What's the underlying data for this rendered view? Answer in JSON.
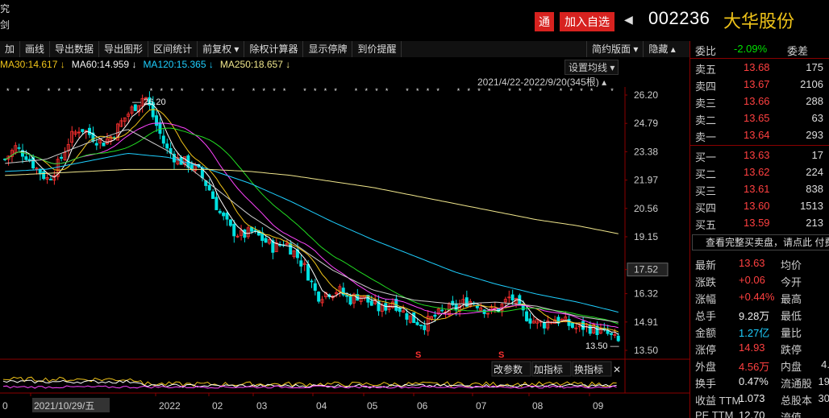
{
  "header": {
    "left_fragment_1": "究",
    "left_fragment_2": "剑",
    "tong_label": "通",
    "add_fav_label": "加入自选",
    "back_arrow": "◀",
    "code": "002236",
    "name": "大华股份"
  },
  "toolbar": {
    "items": [
      "加",
      "画线",
      "导出数据",
      "导出图形",
      "区间统计",
      "前复权 ▾",
      "除权计算器",
      "显示停牌",
      "到价提醒"
    ],
    "right": [
      "简约版面 ▾",
      "隐藏 ▴"
    ]
  },
  "ma_legend": [
    {
      "label": "MA30:14.617 ↓",
      "color": "#f0c419"
    },
    {
      "label": "MA60:14.959 ↓",
      "color": "#eeeeee"
    },
    {
      "label": "MA120:15.365 ↓",
      "color": "#1ecfff"
    },
    {
      "label": "MA250:18.657 ↓",
      "color": "#f0e68c"
    }
  ],
  "set_ma_label": "设置均线 ▾",
  "date_range_label": "2021/4/22-2022/9/20(345根) ▴",
  "colors": {
    "up": "#ff3030",
    "down": "#00e0e0",
    "ma5": "#ffffff",
    "ma10": "#f0c419",
    "ma20": "#ff44ff",
    "ma30": "#22dd22",
    "ma60": "#cccccc",
    "ma120": "#1ecfff",
    "ma250": "#f0e68c"
  },
  "chart_data": {
    "type": "candlestick",
    "y_ticks": [
      "26.20",
      "24.79",
      "23.38",
      "21.97",
      "20.56",
      "19.15",
      "17.52",
      "16.32",
      "14.91",
      "13.50"
    ],
    "ylim": [
      13.5,
      26.2
    ],
    "current_price_tag": "17.52",
    "high_label": "26.20",
    "low_label": "13.50",
    "x_labels": [
      "0",
      "2021/10/29/五",
      "2022",
      "02",
      "03",
      "04",
      "05",
      "06",
      "07",
      "08",
      "09"
    ],
    "markers": [
      "S",
      "S"
    ],
    "price_path": [
      23.0,
      23.6,
      23.2,
      22.5,
      22.0,
      22.8,
      24.0,
      24.6,
      24.2,
      23.8,
      24.2,
      25.0,
      25.6,
      26.2,
      24.8,
      23.5,
      23.0,
      22.8,
      22.4,
      21.5,
      20.3,
      19.5,
      19.2,
      19.4,
      19.0,
      18.6,
      18.9,
      18.3,
      17.5,
      16.2,
      16.4,
      16.5,
      16.0,
      16.3,
      15.8,
      15.5,
      16.0,
      15.4,
      15.0,
      14.8,
      15.2,
      15.5,
      15.6,
      16.0,
      15.8,
      15.4,
      15.6,
      16.2,
      15.4,
      15.0,
      14.8,
      15.1,
      14.9,
      14.6,
      14.7,
      14.5,
      14.3,
      13.9
    ],
    "ma_lines": {
      "ma250": [
        22.2,
        22.3,
        22.4,
        22.5,
        22.5,
        22.5,
        22.4,
        22.2,
        21.9,
        21.6,
        21.2,
        20.8,
        20.4,
        20.0,
        19.7,
        19.3
      ],
      "ma120": [
        22.4,
        22.5,
        22.9,
        23.3,
        23.1,
        22.5,
        21.8,
        20.9,
        19.9,
        19.0,
        18.2,
        17.4,
        16.8,
        16.3,
        15.9,
        15.4
      ],
      "ma60": [
        22.8,
        23.0,
        23.8,
        24.5,
        23.4,
        21.8,
        20.2,
        18.9,
        17.5,
        16.5,
        16.0,
        15.8,
        15.9,
        15.7,
        15.2,
        14.9
      ]
    },
    "volume_axis_labels": [
      "改参数",
      "加指标",
      "换指标",
      "✕"
    ]
  },
  "right_panel": {
    "weibi_label": "委比",
    "weibi_value": "-2.09%",
    "weicha_label": "委差",
    "sell": [
      {
        "label": "卖五",
        "price": "13.68",
        "vol": "175"
      },
      {
        "label": "卖四",
        "price": "13.67",
        "vol": "2106"
      },
      {
        "label": "卖三",
        "price": "13.66",
        "vol": "288"
      },
      {
        "label": "卖二",
        "price": "13.65",
        "vol": "63"
      },
      {
        "label": "卖一",
        "price": "13.64",
        "vol": "293"
      }
    ],
    "buy": [
      {
        "label": "买一",
        "price": "13.63",
        "vol": "17"
      },
      {
        "label": "买二",
        "price": "13.62",
        "vol": "224"
      },
      {
        "label": "买三",
        "price": "13.61",
        "vol": "838"
      },
      {
        "label": "买四",
        "price": "13.60",
        "vol": "1513"
      },
      {
        "label": "买五",
        "price": "13.59",
        "vol": "213"
      }
    ],
    "full_book_label": "查看完整买卖盘，请点此 付费",
    "stats": [
      {
        "l1": "最新",
        "v1": "13.63",
        "c1": "red",
        "l2": "均价",
        "v2": ""
      },
      {
        "l1": "涨跌",
        "v1": "+0.06",
        "c1": "red",
        "l2": "今开",
        "v2": ""
      },
      {
        "l1": "涨幅",
        "v1": "+0.44%",
        "c1": "red",
        "l2": "最高",
        "v2": ""
      },
      {
        "l1": "总手",
        "v1": "9.28万",
        "c1": "white",
        "l2": "最低",
        "v2": ""
      },
      {
        "l1": "金额",
        "v1": "1.27亿",
        "c1": "cyan",
        "l2": "量比",
        "v2": ""
      },
      {
        "l1": "涨停",
        "v1": "14.93",
        "c1": "red",
        "l2": "跌停",
        "v2": ""
      },
      {
        "l1": "外盘",
        "v1": "4.56万",
        "c1": "red",
        "l2": "内盘",
        "v2": "4."
      },
      {
        "l1": "换手",
        "v1": "0.47%",
        "c1": "white",
        "l2": "流通股",
        "v2": "19"
      },
      {
        "l1": "收益 TTM",
        "v1": "1.073",
        "c1": "white",
        "l2": "总股本",
        "v2": "30"
      },
      {
        "l1": "PE TTM",
        "v1": "12.70",
        "c1": "white",
        "l2": "流值",
        "v2": ""
      }
    ]
  }
}
